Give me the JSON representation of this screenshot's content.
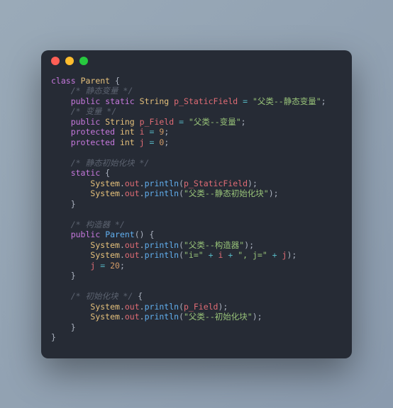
{
  "window": {
    "dots": [
      "red",
      "yellow",
      "green"
    ]
  },
  "code": {
    "l1": {
      "kw_class": "class",
      "name": "Parent",
      "brace": " {"
    },
    "l2": {
      "cmt": "/* 静态变量 */"
    },
    "l3": {
      "kw_public": "public",
      "kw_static": "static",
      "type": "String",
      "ident": "p_StaticField",
      "eq": " = ",
      "str": "\"父类--静态变量\"",
      "semi": ";"
    },
    "l4": {
      "cmt": "/* 变量 */"
    },
    "l5": {
      "kw_public": "public",
      "type": "String",
      "ident": "p_Field",
      "eq": " = ",
      "str": "\"父类--变量\"",
      "semi": ";"
    },
    "l6": {
      "kw_protected": "protected",
      "type": "int",
      "ident": "i",
      "eq": " = ",
      "num": "9",
      "semi": ";"
    },
    "l7": {
      "kw_protected": "protected",
      "type": "int",
      "ident": "j",
      "eq": " = ",
      "num": "0",
      "semi": ";"
    },
    "l9": {
      "cmt": "/* 静态初始化块 */"
    },
    "l10": {
      "kw_static": "static",
      "brace": " {"
    },
    "l11": {
      "sys": "System",
      "dot1": ".",
      "out": "out",
      "dot2": ".",
      "println": "println",
      "lp": "(",
      "arg": "p_StaticField",
      "rp": ");"
    },
    "l12": {
      "sys": "System",
      "dot1": ".",
      "out": "out",
      "dot2": ".",
      "println": "println",
      "lp": "(",
      "str": "\"父类--静态初始化块\"",
      "rp": ");"
    },
    "l13": {
      "brace": "}"
    },
    "l15": {
      "cmt": "/* 构造器 */"
    },
    "l16": {
      "kw_public": "public",
      "name": "Parent",
      "parens": "() {"
    },
    "l17": {
      "sys": "System",
      "dot1": ".",
      "out": "out",
      "dot2": ".",
      "println": "println",
      "lp": "(",
      "str": "\"父类--构造器\"",
      "rp": ");"
    },
    "l18": {
      "sys": "System",
      "dot1": ".",
      "out": "out",
      "dot2": ".",
      "println": "println",
      "lp": "(",
      "s1": "\"i=\"",
      "plus1": " + ",
      "v1": "i",
      "plus2": " + ",
      "s2": "\", j=\"",
      "plus3": " + ",
      "v2": "j",
      "rp": ");"
    },
    "l19": {
      "ident": "j",
      "eq": " = ",
      "num": "20",
      "semi": ";"
    },
    "l20": {
      "brace": "}"
    },
    "l22": {
      "cmt": "/* 初始化块 */",
      "brace": " {"
    },
    "l23": {
      "sys": "System",
      "dot1": ".",
      "out": "out",
      "dot2": ".",
      "println": "println",
      "lp": "(",
      "arg": "p_Field",
      "rp": ");"
    },
    "l24": {
      "sys": "System",
      "dot1": ".",
      "out": "out",
      "dot2": ".",
      "println": "println",
      "lp": "(",
      "str": "\"父类--初始化块\"",
      "rp": ");"
    },
    "l25": {
      "brace": "}"
    },
    "l26": {
      "brace": "}"
    }
  }
}
